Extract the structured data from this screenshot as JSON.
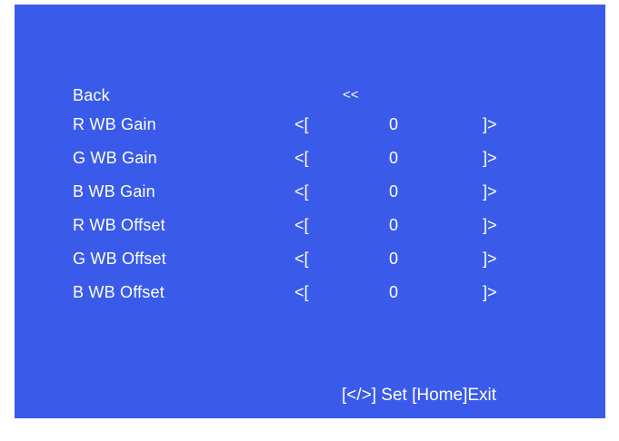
{
  "menu": {
    "back": {
      "label": "Back",
      "arrow": "<<"
    },
    "items": [
      {
        "label": "R WB Gain",
        "left": "<[",
        "value": "0",
        "right": "]>"
      },
      {
        "label": "G WB Gain",
        "left": "<[",
        "value": "0",
        "right": "]>"
      },
      {
        "label": "B WB Gain",
        "left": "<[",
        "value": "0",
        "right": "]>"
      },
      {
        "label": "R WB Offset",
        "left": "<[",
        "value": "0",
        "right": "]>"
      },
      {
        "label": "G WB Offset",
        "left": "<[",
        "value": "0",
        "right": "]>"
      },
      {
        "label": "B WB Offset",
        "left": "<[",
        "value": "0",
        "right": "]>"
      }
    ]
  },
  "footer": {
    "hint": "[</>] Set [Home]Exit"
  },
  "colors": {
    "background": "#3a5be9",
    "text": "#ffffff"
  }
}
